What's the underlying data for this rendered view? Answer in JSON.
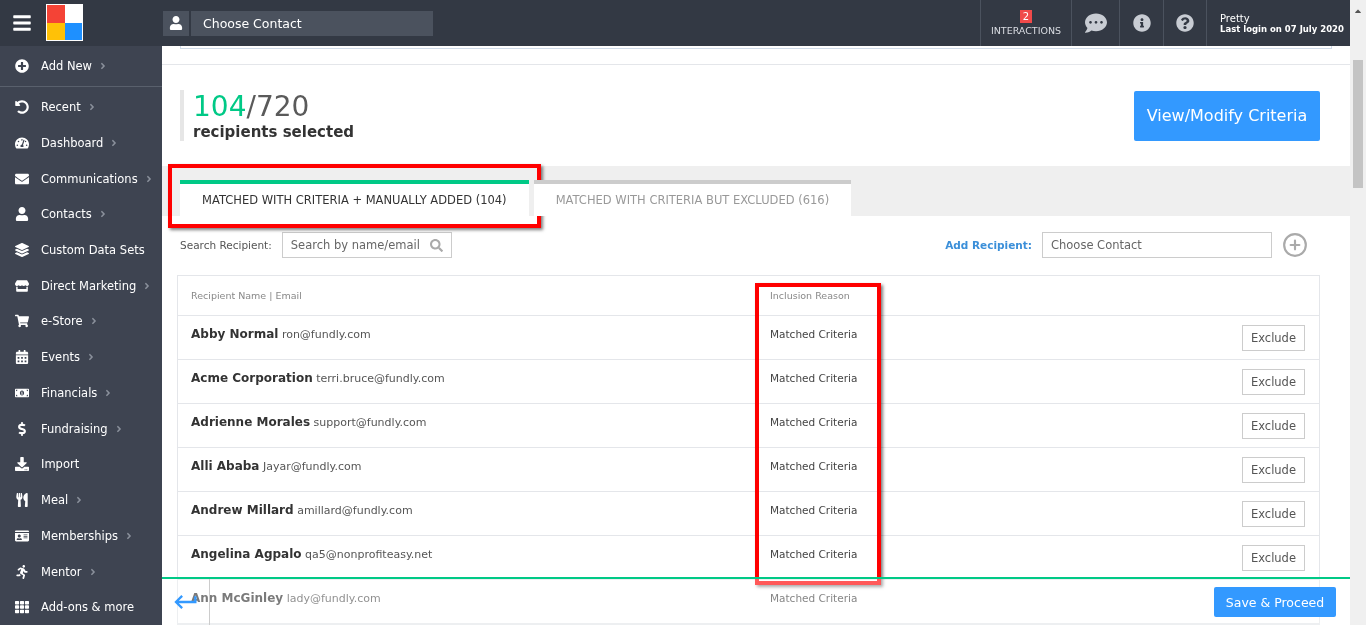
{
  "header": {
    "contact_placeholder": "Choose Contact",
    "interactions": {
      "count": "2",
      "label": "INTERACTIONS"
    },
    "user": {
      "name": "Pretty",
      "last_login": "Last login on 07 July 2020"
    }
  },
  "sidebar": {
    "items": [
      {
        "label": "Add New",
        "submenu": true
      },
      {
        "label": "Recent",
        "submenu": true
      },
      {
        "label": "Dashboard",
        "submenu": true
      },
      {
        "label": "Communications",
        "submenu": true
      },
      {
        "label": "Contacts",
        "submenu": true
      },
      {
        "label": "Custom Data Sets",
        "submenu": false
      },
      {
        "label": "Direct Marketing",
        "submenu": true
      },
      {
        "label": "e-Store",
        "submenu": true
      },
      {
        "label": "Events",
        "submenu": true
      },
      {
        "label": "Financials",
        "submenu": true
      },
      {
        "label": "Fundraising",
        "submenu": true
      },
      {
        "label": "Import",
        "submenu": false
      },
      {
        "label": "Meal",
        "submenu": true
      },
      {
        "label": "Memberships",
        "submenu": true
      },
      {
        "label": "Mentor",
        "submenu": true
      },
      {
        "label": "Add-ons & more",
        "submenu": false
      }
    ]
  },
  "summary": {
    "selected": "104",
    "total": "/720",
    "caption": "recipients selected",
    "button": "View/Modify Criteria"
  },
  "tabs": [
    {
      "label": "MATCHED WITH CRITERIA + MANUALLY ADDED (104)",
      "selected": true,
      "highlighted": true
    },
    {
      "label": "MATCHED WITH CRITERIA BUT EXCLUDED (616)",
      "selected": false,
      "highlighted": false
    }
  ],
  "search": {
    "label": "Search Recipient:",
    "placeholder": "Search by name/email"
  },
  "add_recipient": {
    "label": "Add Recipient:",
    "placeholder": "Choose Contact"
  },
  "table": {
    "columns": [
      "Recipient Name | Email",
      "Inclusion Reason"
    ],
    "reason_highlighted": true,
    "rows": [
      {
        "name": "Abby Normal",
        "email": "ron@fundly.com",
        "reason": "Matched Criteria",
        "action": "Exclude"
      },
      {
        "name": "Acme Corporation",
        "email": "terri.bruce@fundly.com",
        "reason": "Matched Criteria",
        "action": "Exclude"
      },
      {
        "name": "Adrienne Morales",
        "email": "support@fundly.com",
        "reason": "Matched Criteria",
        "action": "Exclude"
      },
      {
        "name": "Alli Ababa",
        "email": "Jayar@fundly.com",
        "reason": "Matched Criteria",
        "action": "Exclude"
      },
      {
        "name": "Andrew Millard",
        "email": "amillard@fundly.com",
        "reason": "Matched Criteria",
        "action": "Exclude"
      },
      {
        "name": "Angelina Agpalo",
        "email": "qa5@nonprofiteasy.net",
        "reason": "Matched Criteria",
        "action": "Exclude"
      },
      {
        "name": "Ann McGinley",
        "email": "lady@fundly.com",
        "reason": "Matched Criteria"
      }
    ]
  },
  "footer": {
    "button": "Save & Proceed"
  }
}
